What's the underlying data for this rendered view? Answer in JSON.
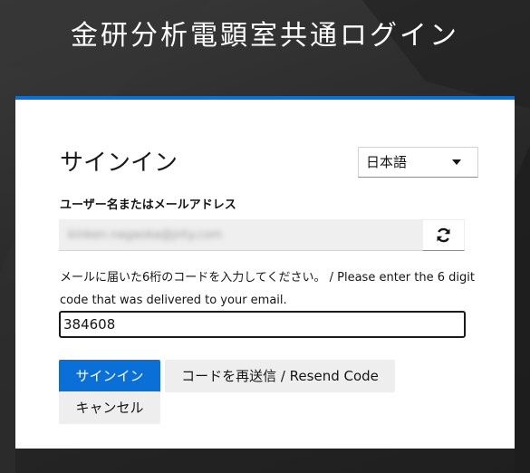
{
  "header": {
    "title": "金研分析電顕室共通ログイン"
  },
  "login": {
    "title": "サインイン",
    "language": {
      "selected": "日本語"
    },
    "username": {
      "label": "ユーザー名またはメールアドレス",
      "value": "kinken.nagaoka@jnty.com"
    },
    "otp": {
      "instruction": "メールに届いた6桁のコードを入力してください。 / Please enter the 6 digit code that was delivered to your email.",
      "value": "384608"
    },
    "buttons": {
      "signin": "サインイン",
      "resend": "コードを再送信 / Resend Code",
      "cancel": "キャンセル"
    }
  },
  "colors": {
    "accent": "#0b6fd8",
    "background": "#2b2b2b",
    "card": "#ffffff",
    "button_secondary": "#eeeeee"
  },
  "icons": {
    "refresh": "refresh-icon",
    "language_dropdown": "caret-down-icon"
  }
}
